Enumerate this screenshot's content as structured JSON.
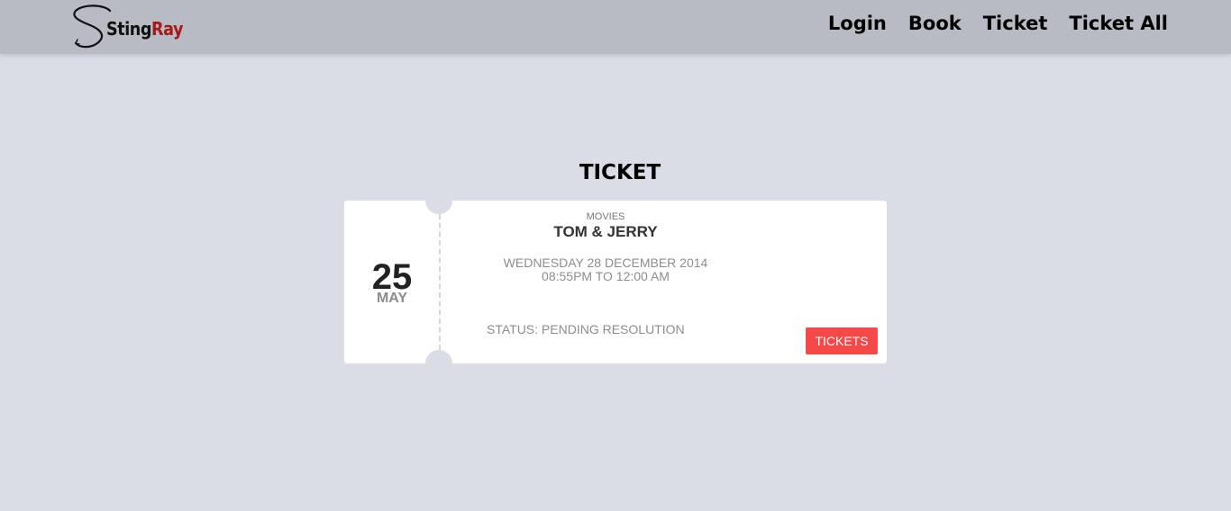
{
  "brand": {
    "logo_text_part1": "Sting",
    "logo_text_part2": "Ray",
    "accent_color": "#a81818"
  },
  "nav": {
    "items": [
      {
        "label": "Login"
      },
      {
        "label": "Book"
      },
      {
        "label": "Ticket"
      },
      {
        "label": "Ticket All"
      }
    ]
  },
  "page": {
    "title": "TICKET"
  },
  "ticket": {
    "day": "25",
    "month": "MAY",
    "category": "MOVIES",
    "event_name": "TOM & JERRY",
    "event_date": "WEDNESDAY 28 DECEMBER 2014",
    "event_time": "08:55PM TO 12:00 AM",
    "status": "STATUS: PENDING RESOLUTION",
    "button_label": "TICKETS",
    "button_color": "#f54848"
  },
  "colors": {
    "background": "#dadce6",
    "navbar": "#b8bac4",
    "card": "#ffffff"
  }
}
